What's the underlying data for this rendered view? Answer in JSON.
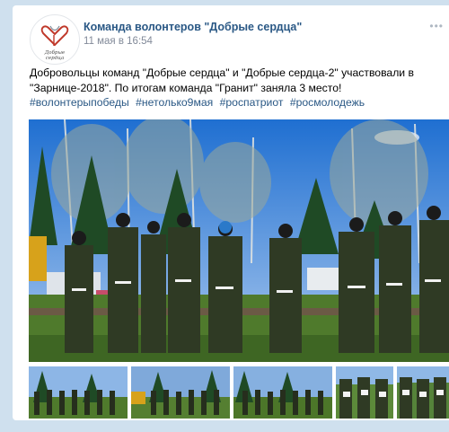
{
  "post": {
    "author": "Команда волонтеров \"Добрые сердца\"",
    "date": "11 мая в 16:54",
    "text": "Добровольцы команд \"Добрые сердца\" и \"Добрые сердца-2\" участвовали в \"Зарнице-2018\". По итогам команда \"Гранит\" заняла 3 место!",
    "hashtags": [
      "#волонтерыпобеды",
      "#нетолько9мая",
      "#роспатриот",
      "#росмолодежь"
    ],
    "more_label": "•••"
  },
  "logo": {
    "lettering": "Добрые сердца",
    "color": "#c0392b"
  },
  "colors": {
    "link": "#2a5885",
    "meta": "#828a99",
    "page_bg": "#cfe0ee"
  },
  "media": {
    "main_photo": "group-photo-cadets-in-uniform",
    "thumbnails": [
      "thumb-cadets-formation-1",
      "thumb-cadets-formation-2",
      "thumb-cadets-formation-3",
      "thumb-cadets-with-certificates-1",
      "thumb-cadets-with-certificates-2"
    ]
  }
}
